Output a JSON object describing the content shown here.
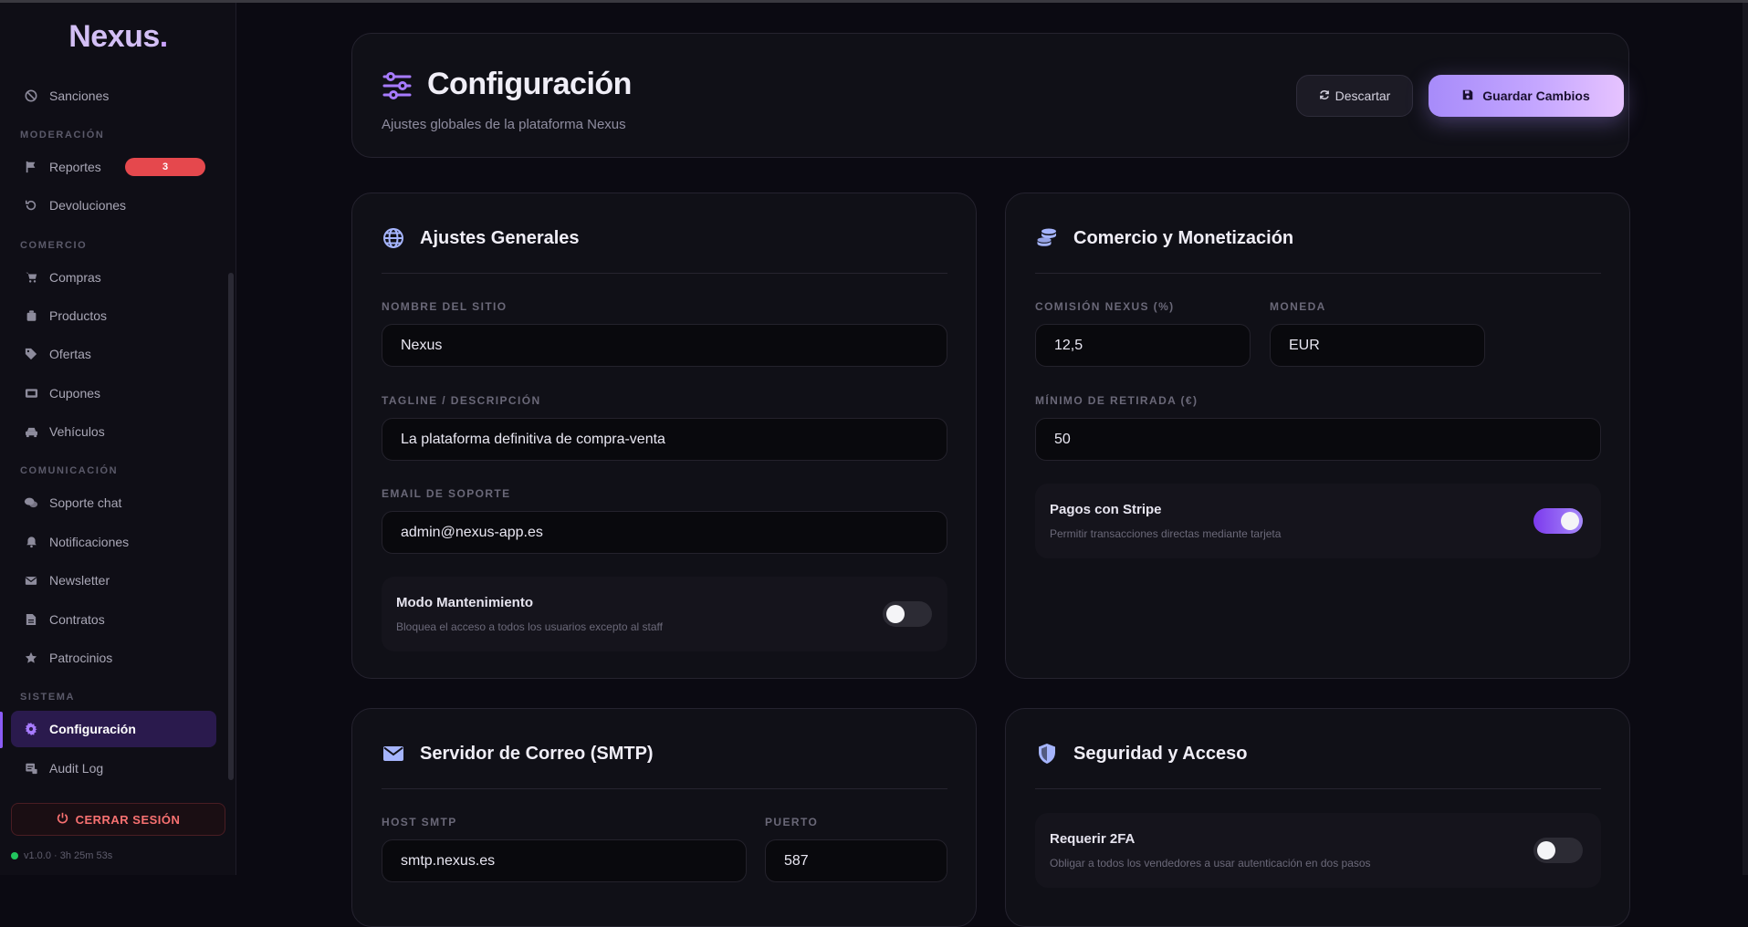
{
  "brand": {
    "name": "Nexus",
    "dot": "."
  },
  "sidebar": {
    "items": [
      {
        "label": "Sanciones",
        "icon": "ban-icon"
      },
      {
        "label": "Reportes",
        "icon": "flag-icon",
        "badge": "3"
      },
      {
        "label": "Devoluciones",
        "icon": "undo-icon"
      },
      {
        "label": "Compras",
        "icon": "cart-icon"
      },
      {
        "label": "Productos",
        "icon": "box-icon"
      },
      {
        "label": "Ofertas",
        "icon": "tag-icon"
      },
      {
        "label": "Cupones",
        "icon": "ticket-icon"
      },
      {
        "label": "Vehículos",
        "icon": "car-icon"
      },
      {
        "label": "Soporte chat",
        "icon": "chat-icon"
      },
      {
        "label": "Notificaciones",
        "icon": "bell-icon"
      },
      {
        "label": "Newsletter",
        "icon": "mail-icon"
      },
      {
        "label": "Contratos",
        "icon": "document-icon"
      },
      {
        "label": "Patrocinios",
        "icon": "star-icon"
      },
      {
        "label": "Configuración",
        "icon": "gear-icon",
        "active": true
      },
      {
        "label": "Audit Log",
        "icon": "log-icon"
      }
    ],
    "sections": {
      "moderacion": "MODERACIÓN",
      "comercio": "COMERCIO",
      "comunicacion": "COMUNICACIÓN",
      "sistema": "SISTEMA"
    },
    "logout": "CERRAR SESIÓN",
    "version": "v1.0.0 · 3h 25m 53s"
  },
  "header": {
    "title": "Configuración",
    "subtitle": "Ajustes globales de la plataforma Nexus",
    "discard": "Descartar",
    "save": "Guardar Cambios"
  },
  "general": {
    "title": "Ajustes Generales",
    "site_name_label": "NOMBRE DEL SITIO",
    "site_name": "Nexus",
    "tagline_label": "TAGLINE / DESCRIPCIÓN",
    "tagline": "La plataforma definitiva de compra-venta",
    "email_label": "EMAIL DE SOPORTE",
    "email": "admin@nexus-app.es",
    "maintenance_title": "Modo Mantenimiento",
    "maintenance_desc": "Bloquea el acceso a todos los usuarios excepto al staff",
    "maintenance_on": false
  },
  "commerce": {
    "title": "Comercio y Monetización",
    "commission_label": "COMISIÓN NEXUS (%)",
    "commission": "12,5",
    "currency_label": "MONEDA",
    "currency": "EUR",
    "min_withdraw_label": "MÍNIMO DE RETIRADA (€)",
    "min_withdraw": "50",
    "stripe_title": "Pagos con Stripe",
    "stripe_desc": "Permitir transacciones directas mediante tarjeta",
    "stripe_on": true
  },
  "smtp": {
    "title": "Servidor de Correo (SMTP)",
    "host_label": "HOST SMTP",
    "host": "smtp.nexus.es",
    "port_label": "PUERTO",
    "port": "587"
  },
  "security": {
    "title": "Seguridad y Acceso",
    "twofa_title": "Requerir 2FA",
    "twofa_desc": "Obligar a todos los vendedores a usar autenticación en dos pasos",
    "twofa_on": false
  },
  "colors": {
    "accent": "#a78bfa",
    "danger": "#e5484d",
    "online": "#22c55e"
  }
}
